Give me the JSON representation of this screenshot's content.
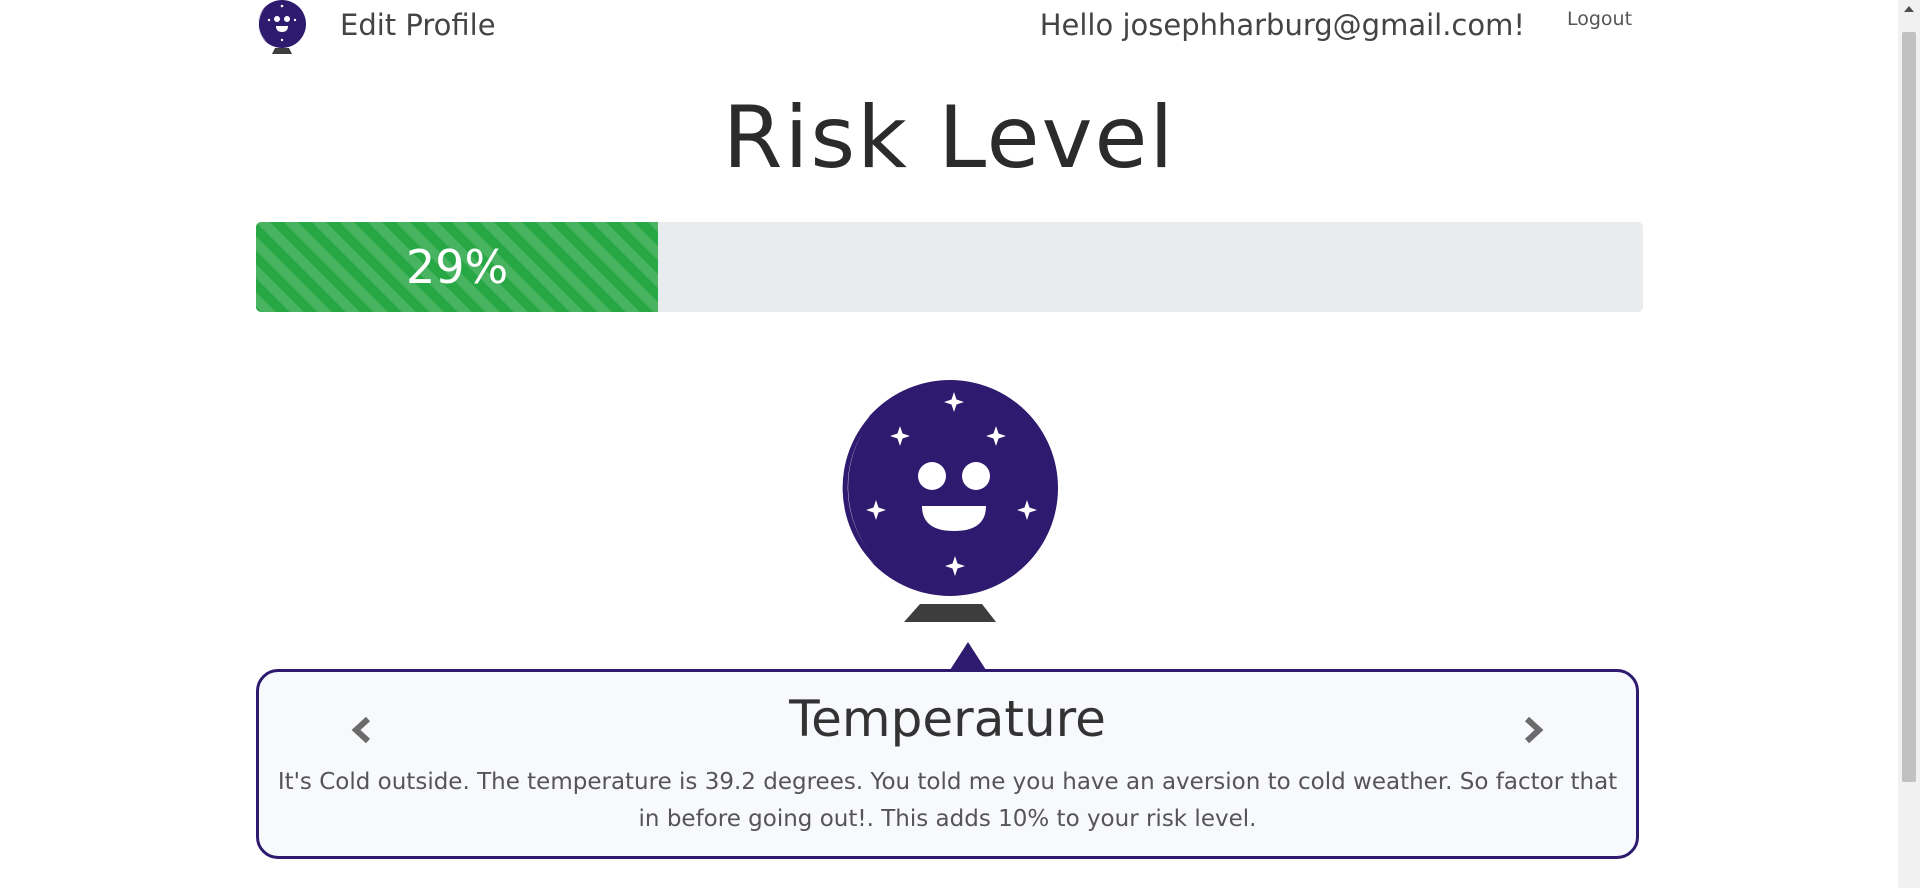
{
  "nav": {
    "edit_profile_label": "Edit Profile",
    "greeting": "Hello josephharburg@gmail.com!",
    "logout_label": "Logout",
    "logo_icon": "crystal-ball-logo-icon"
  },
  "page_title": "Risk Level",
  "risk": {
    "percent": 29,
    "label": "29%"
  },
  "mascot_icon": "crystal-ball-icon",
  "card": {
    "title": "Temperature",
    "text": "It's Cold outside. The temperature is 39.2 degrees. You told me you have an aversion to cold weather. So factor that in before going out!. This adds 10% to your risk level.",
    "prev_icon": "chevron-left-icon",
    "next_icon": "chevron-right-icon"
  },
  "colors": {
    "brand_purple": "#2e1a6e",
    "progress_green": "#28a745",
    "progress_track": "#e9ecef",
    "card_background": "#f8f9fd"
  }
}
